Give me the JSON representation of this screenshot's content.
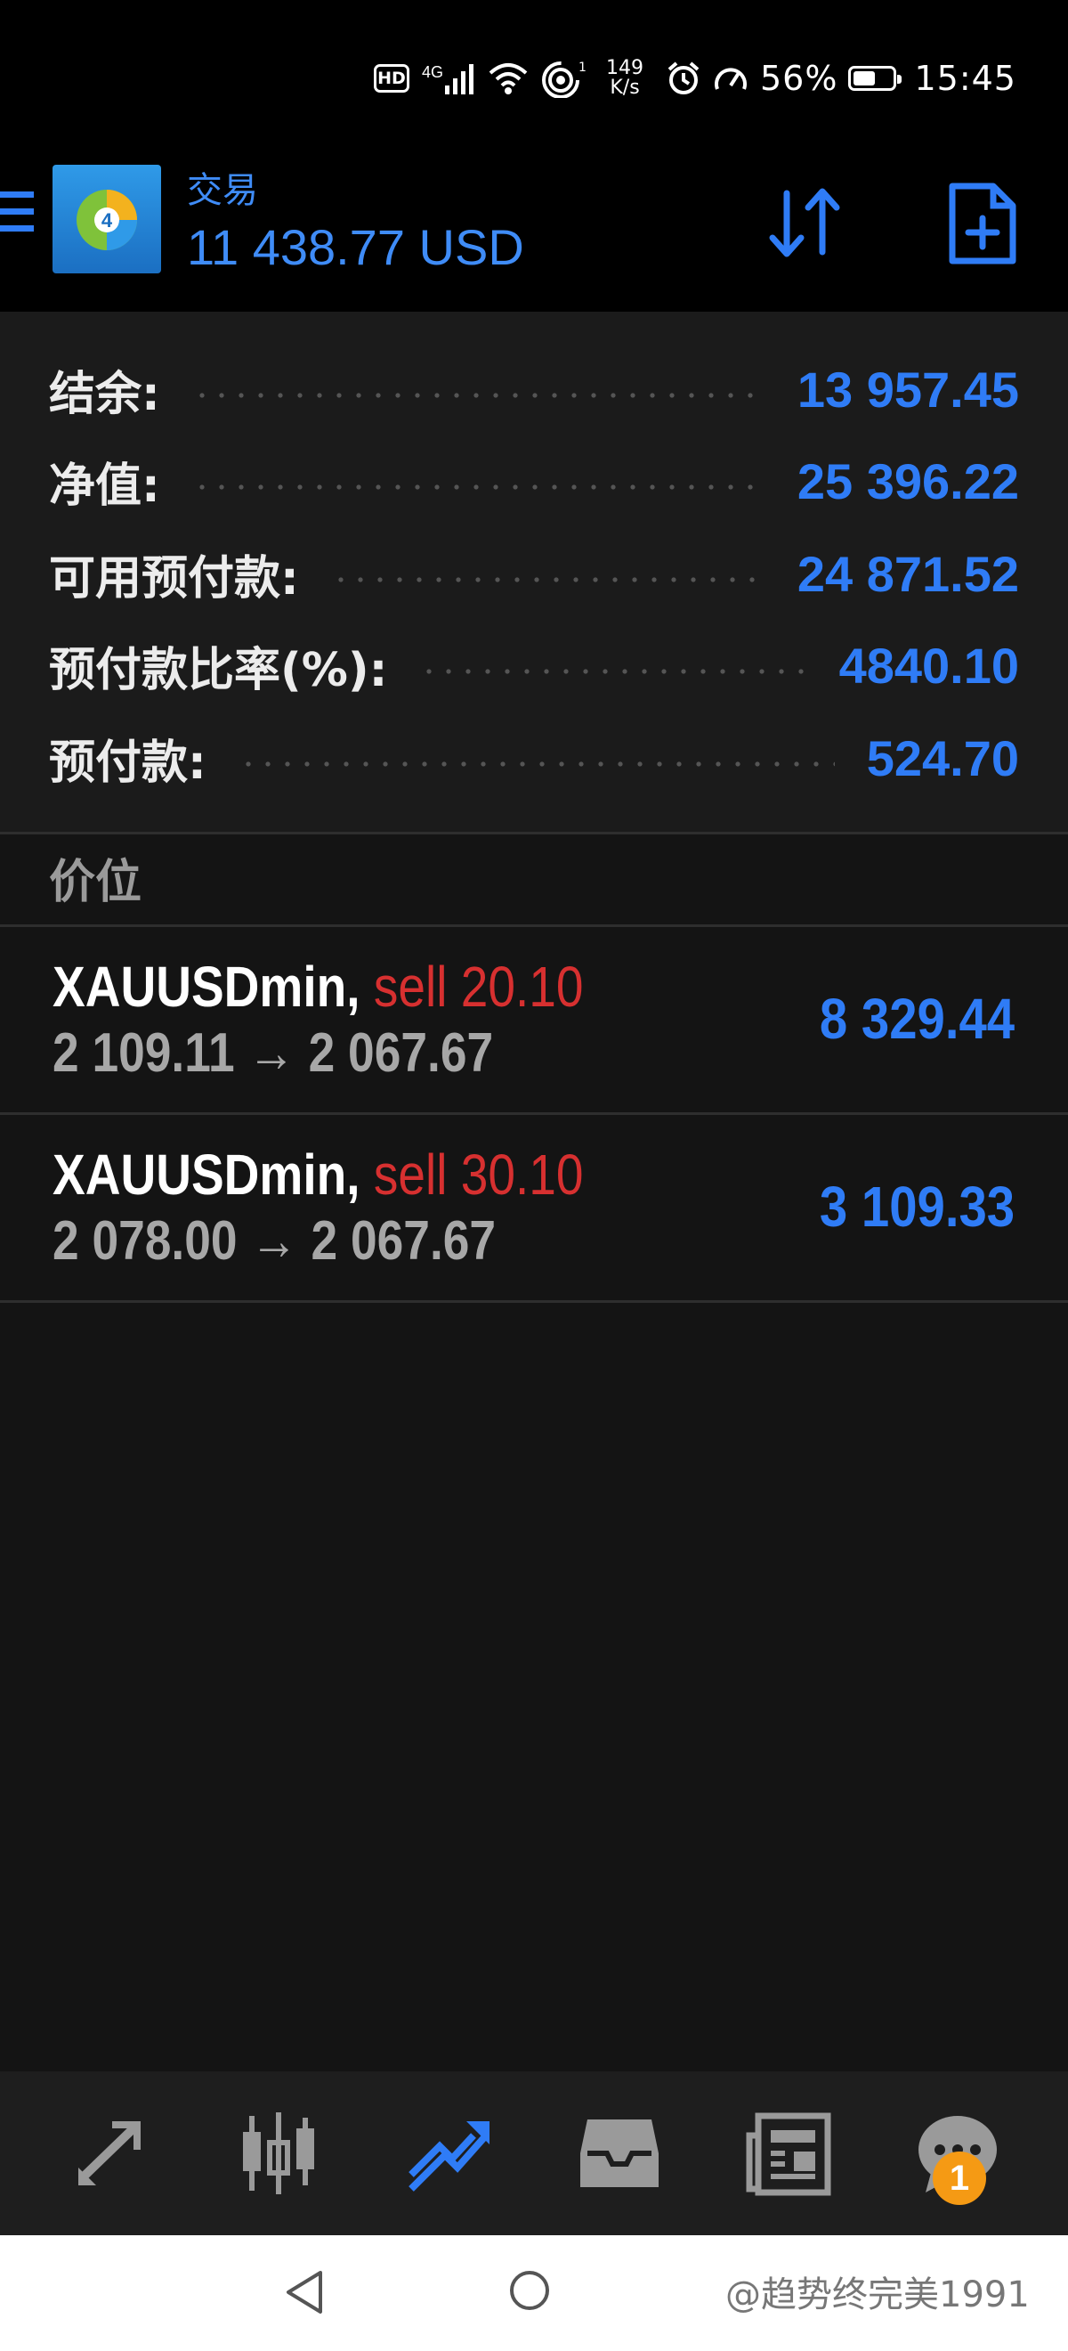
{
  "status_bar": {
    "hd": "HD",
    "network": "4G",
    "speed_value": "149",
    "speed_unit": "K/s",
    "battery_text": "56%",
    "battery_level": 0.56,
    "time": "15:45",
    "icons": [
      "signal-icon",
      "wifi-icon",
      "hotspot-icon",
      "alarm-icon",
      "speedometer-icon",
      "battery-icon"
    ]
  },
  "header": {
    "title": "交易",
    "balance": "11 438.77 USD",
    "logo": "metatrader-4-logo",
    "actions": [
      "sort-icon",
      "new-order-icon"
    ]
  },
  "summary": [
    {
      "label": "结余:",
      "value": "13 957.45"
    },
    {
      "label": "净值:",
      "value": "25 396.22"
    },
    {
      "label": "可用预付款:",
      "value": "24 871.52"
    },
    {
      "label": "预付款比率(%):",
      "value": "4840.10"
    },
    {
      "label": "预付款:",
      "value": "524.70"
    }
  ],
  "section_title": "价位",
  "positions": [
    {
      "symbol": "XAUUSDmin,",
      "side": "sell 20.10",
      "open": "2 109.11",
      "arrow": "→",
      "current": "2 067.67",
      "profit": "8 329.44"
    },
    {
      "symbol": "XAUUSDmin,",
      "side": "sell 30.10",
      "open": "2 078.00",
      "arrow": "→",
      "current": "2 067.67",
      "profit": "3 109.33"
    }
  ],
  "tabs": [
    {
      "name": "quotes-icon",
      "active": false
    },
    {
      "name": "chart-icon",
      "active": false
    },
    {
      "name": "trade-icon",
      "active": true
    },
    {
      "name": "history-icon",
      "active": false
    },
    {
      "name": "news-icon",
      "active": false
    },
    {
      "name": "messages-icon",
      "active": false
    }
  ],
  "messages_badge": "1",
  "watermark": "@趋势终完美1991",
  "colors": {
    "accent": "#2f7cf6",
    "sell": "#d73030",
    "badge": "#f59a14",
    "background": "#141414"
  }
}
